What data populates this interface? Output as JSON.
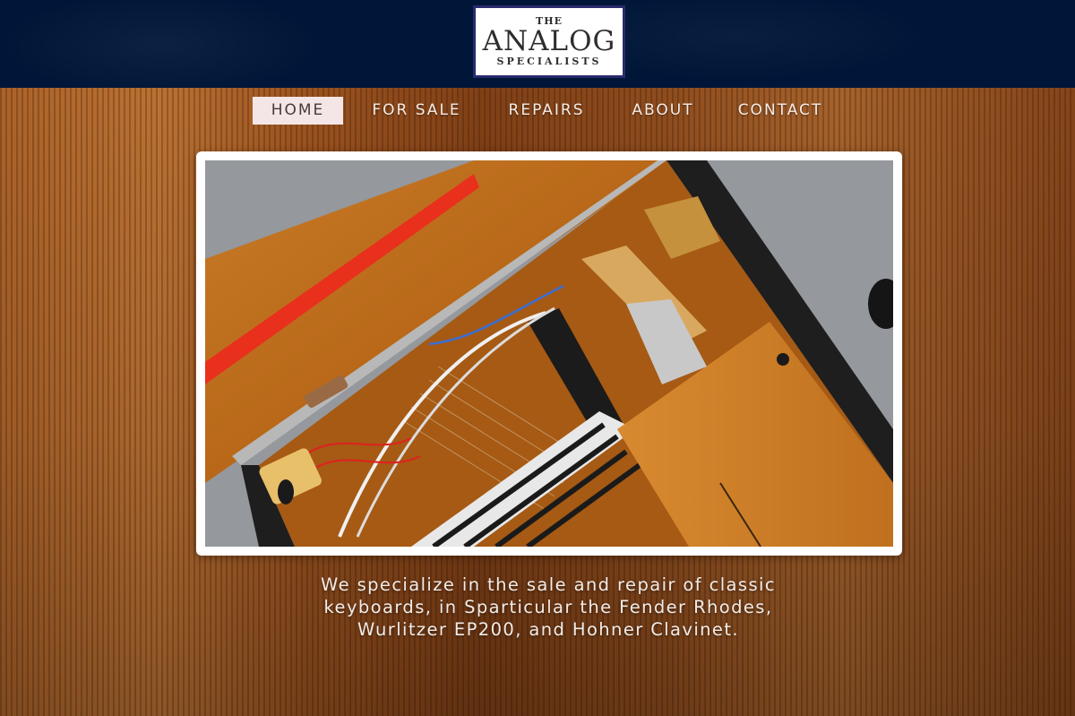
{
  "logo": {
    "the": "THE",
    "main": "ANALOG",
    "sub": "SPECIALISTS"
  },
  "nav": {
    "items": [
      {
        "label": "HOME",
        "active": true
      },
      {
        "label": "FOR SALE",
        "active": false
      },
      {
        "label": "REPAIRS",
        "active": false
      },
      {
        "label": "ABOUT",
        "active": false
      },
      {
        "label": "CONTACT",
        "active": false
      }
    ]
  },
  "tagline": {
    "line1": "We specialize in the sale and repair of classic",
    "line2": "keyboards, in Sparticular the Fender Rhodes,",
    "line3": "Wurlitzer EP200, and Hohner Clavinet."
  },
  "colors": {
    "header_bg": "#001638",
    "logo_border": "#2a2a6e",
    "nav_active_bg": "#f4e6e6",
    "wood": "#b86a2c"
  }
}
